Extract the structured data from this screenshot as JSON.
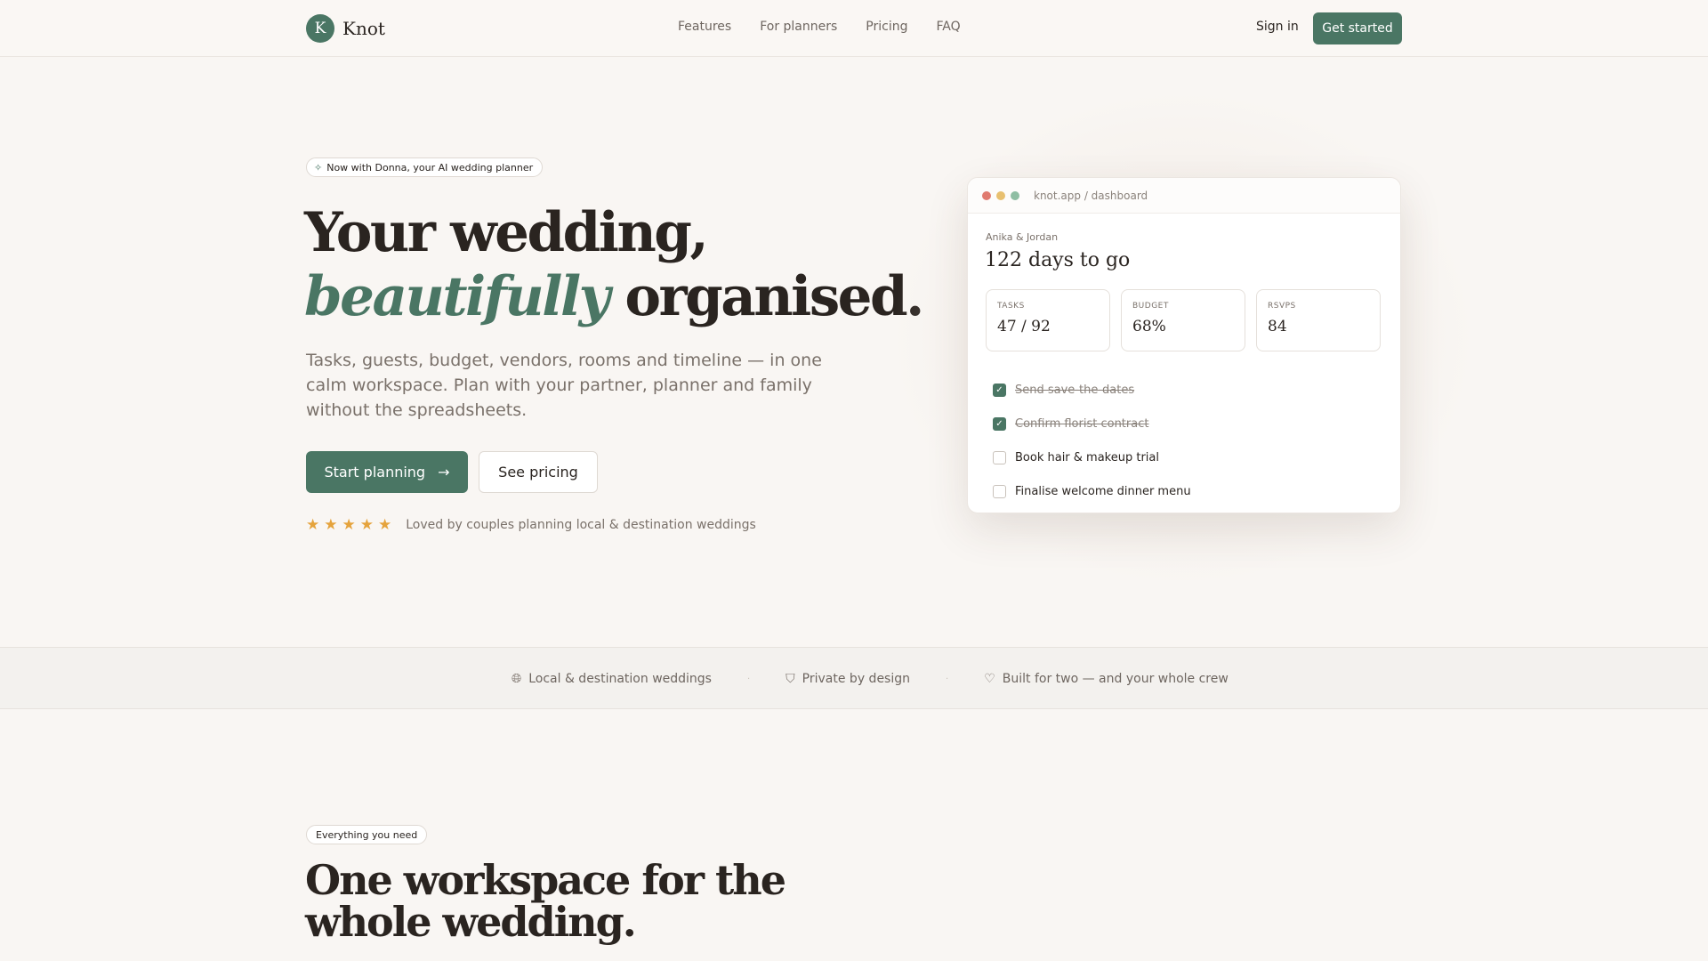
{
  "nav": {
    "logo_letter": "K",
    "logo_text": "Knot",
    "links": [
      "Features",
      "For planners",
      "Pricing",
      "FAQ"
    ],
    "sign_in": "Sign in",
    "get_started": "Get started"
  },
  "hero": {
    "badge_icon": "sparkle-icon",
    "badge": "Now with Donna, your AI wedding planner",
    "title_line1": "Your wedding,",
    "title_accent": "beautifully",
    "title_line2_rest": " organised.",
    "subtitle": "Tasks, guests, budget, vendors, rooms and timeline — in one calm workspace. Plan with your partner, planner and family without the spreadsheets.",
    "primary_button": "Start planning",
    "primary_button_icon": "→",
    "secondary_button": "See pricing",
    "stars": [
      "★",
      "★",
      "★",
      "★",
      "★"
    ],
    "rating_text": "Loved by couples planning local & destination weddings"
  },
  "dashboard": {
    "window_dot_colors": [
      "#e07a6f",
      "#e8c070",
      "#8fbea3"
    ],
    "url": "knot.app / dashboard",
    "couple": "Anika & Jordan",
    "countdown": "122 days to go",
    "stats": [
      {
        "label": "TASKS",
        "value": "47 / 92"
      },
      {
        "label": "BUDGET",
        "value": "68%"
      },
      {
        "label": "RSVPS",
        "value": "84"
      }
    ],
    "tasks": [
      {
        "label": "Send save-the-dates",
        "done": true
      },
      {
        "label": "Confirm florist contract",
        "done": true
      },
      {
        "label": "Book hair & makeup trial",
        "done": false
      },
      {
        "label": "Finalise welcome dinner menu",
        "done": false
      }
    ]
  },
  "features_strip": [
    {
      "icon": "globe-icon",
      "glyph": "🌐︎",
      "label": "Local & destination weddings"
    },
    {
      "icon": "shield-icon",
      "glyph": "⛉",
      "label": "Private by design"
    },
    {
      "icon": "heart-icon",
      "glyph": "♡",
      "label": "Built for two — and your whole crew"
    }
  ],
  "section": {
    "badge": "Everything you need",
    "title": "One workspace for the whole wedding."
  },
  "colors": {
    "accent": "#4a7664",
    "background": "#f9f6f3",
    "star": "#e5a33c"
  }
}
